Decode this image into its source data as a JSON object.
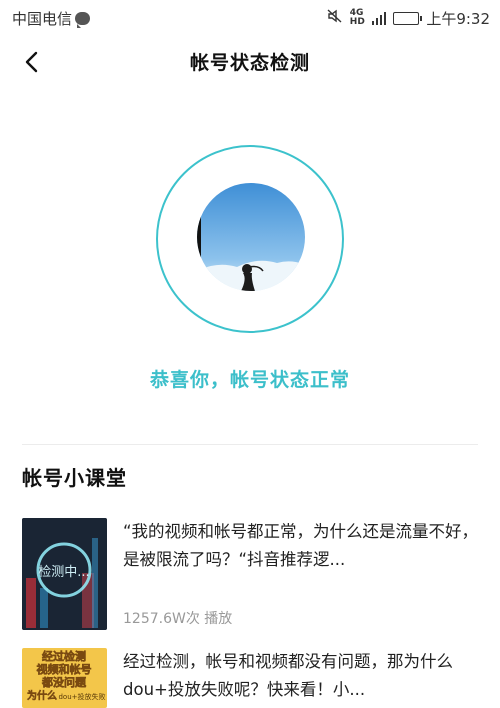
{
  "status_bar": {
    "carrier": "中国电信",
    "network": [
      "4G",
      "HD"
    ],
    "time": "上午9:32",
    "battery_level": 0.3
  },
  "header": {
    "title": "帐号状态检测",
    "back_icon": "chevron-left-icon"
  },
  "status": {
    "message": "恭喜你，帐号状态正常",
    "accent_color": "#3cc2cc"
  },
  "section": {
    "title": "帐号小课堂"
  },
  "articles": [
    {
      "title": "“我的视频和帐号都正常，为什么还是流量不好，是被限流了吗？“抖音推荐逻...",
      "thumb_text": "检测中...",
      "views": "1257.6W次",
      "views_suffix": "播放"
    },
    {
      "title": "经过检测，帐号和视频都没有问题，那为什么dou+投放失败呢？快来看！小...",
      "thumb_lines": [
        "经过检测",
        "视频和帐号",
        "都没问题",
        "为什么",
        "dou+投放失败"
      ]
    }
  ]
}
